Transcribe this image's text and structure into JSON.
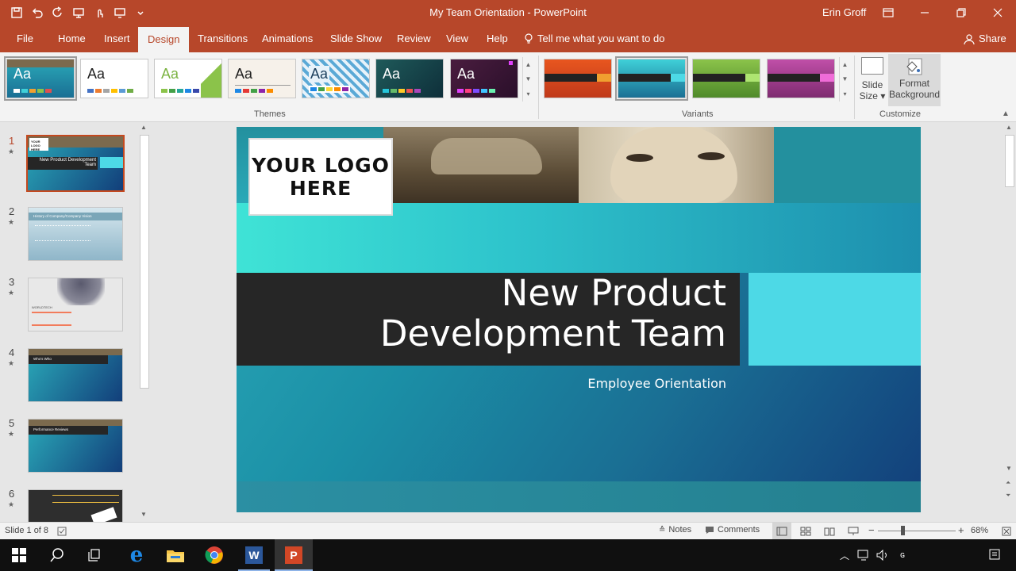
{
  "window": {
    "title": "My Team Orientation  -  PowerPoint",
    "user": "Erin Groff"
  },
  "ribbon_tabs": [
    "File",
    "Home",
    "Insert",
    "Design",
    "Transitions",
    "Animations",
    "Slide Show",
    "Review",
    "View",
    "Help"
  ],
  "active_tab": "Design",
  "tell_me": "Tell me what you want to do",
  "share": "Share",
  "themes": {
    "label": "Themes",
    "items": [
      {
        "aa": "Aa",
        "selected": true
      },
      {
        "aa": "Aa"
      },
      {
        "aa": "Aa"
      },
      {
        "aa": "Aa"
      },
      {
        "aa": "Aa"
      },
      {
        "aa": "Aa"
      },
      {
        "aa": "Aa"
      }
    ]
  },
  "variants": {
    "label": "Variants"
  },
  "customize": {
    "label": "Customize",
    "slide_size_line1": "Slide",
    "slide_size_line2": "Size",
    "format_bg_line1": "Format",
    "format_bg_line2": "Background"
  },
  "thumbnails": [
    {
      "num": "1",
      "title": "New Product Development Team",
      "logo": "YOUR LOGO HERE"
    },
    {
      "num": "2",
      "title": "History of Company/Company Vision"
    },
    {
      "num": "3",
      "title": "WORLDTECH"
    },
    {
      "num": "4",
      "title": "Who's Who"
    },
    {
      "num": "5",
      "title": "Performance Reviews"
    },
    {
      "num": "6"
    }
  ],
  "slide": {
    "logo_line1": "YOUR LOGO",
    "logo_line2": "HERE",
    "title_line1": "New Product",
    "title_line2": "Development Team",
    "subtitle": "Employee Orientation"
  },
  "status": {
    "slide_count": "Slide 1 of 8",
    "notes": "Notes",
    "comments": "Comments",
    "zoom": "68%"
  },
  "colors": {
    "accent": "#b7472a",
    "teal": "#3fd0d8",
    "dark_band": "#262626"
  }
}
